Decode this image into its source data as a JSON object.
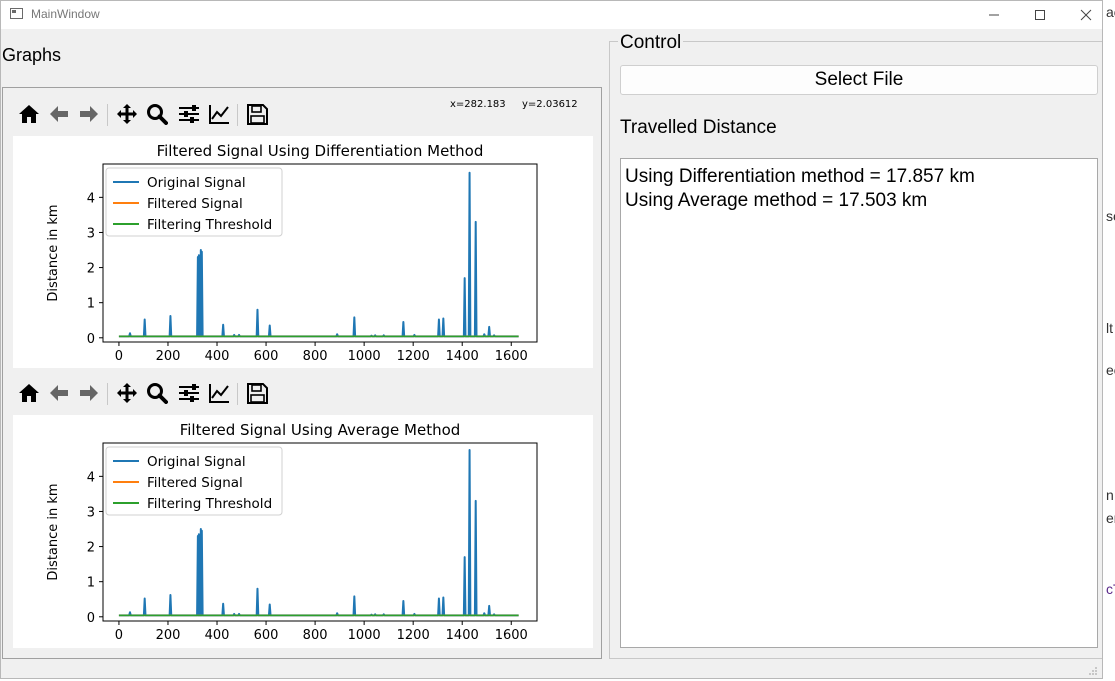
{
  "window": {
    "title": "MainWindow"
  },
  "graphs": {
    "label": "Graphs",
    "toolbar": {
      "coord_x": "x=282.183",
      "coord_y": "y=2.03612"
    }
  },
  "control": {
    "label": "Control",
    "select_button": "Select File",
    "distance_label": "Travelled Distance",
    "results": [
      "Using Differentiation method = 17.857 km",
      "Using Average method = 17.503 km"
    ]
  },
  "background_fragments": [
    "ae",
    "se",
    "lt",
    "ec",
    "n",
    "er",
    "cT"
  ],
  "colors": {
    "original": "#1f77b4",
    "filtered": "#ff7f0e",
    "threshold": "#2ca02c"
  },
  "toolbar_icons": [
    "home-icon",
    "back-arrow-icon",
    "forward-arrow-icon",
    "pan-icon",
    "zoom-icon",
    "configure-subplots-icon",
    "edit-axis-icon",
    "save-icon"
  ],
  "chart_data": [
    {
      "type": "line",
      "title": "Filtered Signal Using Differentiation Method",
      "xlabel": "",
      "ylabel": "Distance in km",
      "xlim": [
        -65,
        1705
      ],
      "ylim": [
        -0.12,
        4.95
      ],
      "xticks": [
        0,
        200,
        400,
        600,
        800,
        1000,
        1200,
        1400,
        1600
      ],
      "yticks": [
        0,
        1,
        2,
        3,
        4
      ],
      "legend": "upper-left",
      "series": [
        {
          "name": "Original Signal",
          "baseline": 0.04,
          "spikes": [
            [
              45,
              0.13
            ],
            [
              105,
              0.52
            ],
            [
              210,
              0.62
            ],
            [
              322,
              2.3
            ],
            [
              326,
              2.35
            ],
            [
              330,
              2.3
            ],
            [
              334,
              2.5
            ],
            [
              338,
              2.45
            ],
            [
              425,
              0.37
            ],
            [
              470,
              0.08
            ],
            [
              490,
              0.08
            ],
            [
              565,
              0.8
            ],
            [
              615,
              0.35
            ],
            [
              890,
              0.1
            ],
            [
              960,
              0.58
            ],
            [
              1030,
              0.06
            ],
            [
              1045,
              0.07
            ],
            [
              1080,
              0.07
            ],
            [
              1160,
              0.45
            ],
            [
              1205,
              0.08
            ],
            [
              1305,
              0.52
            ],
            [
              1323,
              0.55
            ],
            [
              1410,
              1.7
            ],
            [
              1430,
              4.7
            ],
            [
              1455,
              3.3
            ],
            [
              1490,
              0.1
            ],
            [
              1510,
              0.31
            ],
            [
              1530,
              0.07
            ]
          ]
        },
        {
          "name": "Filtered Signal",
          "value": 0.04
        },
        {
          "name": "Filtering Threshold",
          "value": 0.04
        }
      ]
    },
    {
      "type": "line",
      "title": "Filtered Signal Using Average Method",
      "xlabel": "",
      "ylabel": "Distance in km",
      "xlim": [
        -65,
        1705
      ],
      "ylim": [
        -0.12,
        4.95
      ],
      "xticks": [
        0,
        200,
        400,
        600,
        800,
        1000,
        1200,
        1400,
        1600
      ],
      "yticks": [
        0,
        1,
        2,
        3,
        4
      ],
      "legend": "upper-left",
      "series": [
        {
          "name": "Original Signal",
          "baseline": 0.04,
          "spikes": [
            [
              45,
              0.13
            ],
            [
              105,
              0.52
            ],
            [
              210,
              0.62
            ],
            [
              322,
              2.3
            ],
            [
              326,
              2.35
            ],
            [
              330,
              2.3
            ],
            [
              334,
              2.5
            ],
            [
              338,
              2.45
            ],
            [
              425,
              0.37
            ],
            [
              470,
              0.08
            ],
            [
              490,
              0.08
            ],
            [
              565,
              0.8
            ],
            [
              615,
              0.35
            ],
            [
              890,
              0.1
            ],
            [
              960,
              0.58
            ],
            [
              1030,
              0.06
            ],
            [
              1045,
              0.07
            ],
            [
              1080,
              0.07
            ],
            [
              1160,
              0.45
            ],
            [
              1205,
              0.08
            ],
            [
              1305,
              0.52
            ],
            [
              1323,
              0.55
            ],
            [
              1410,
              1.7
            ],
            [
              1430,
              4.75
            ],
            [
              1455,
              3.3
            ],
            [
              1490,
              0.1
            ],
            [
              1510,
              0.31
            ],
            [
              1530,
              0.07
            ]
          ]
        },
        {
          "name": "Filtered Signal",
          "value": 0.04
        },
        {
          "name": "Filtering Threshold",
          "value": 0.04
        }
      ]
    }
  ]
}
